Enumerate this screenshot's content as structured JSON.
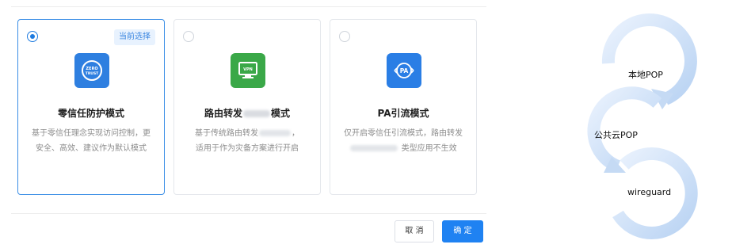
{
  "cards": [
    {
      "id": "zero-trust",
      "title": "零信任防护模式",
      "desc_lines": [
        "基于零信任理念实现访问控制，更",
        "安全、高效、建议作为默认模式"
      ],
      "selected": true,
      "badge": "当前选择",
      "icon": "zero-trust-icon",
      "icon_text_1": "ZERO",
      "icon_text_2": "TRUST"
    },
    {
      "id": "route-forward",
      "title_prefix": "路由转发",
      "title_suffix": "模式",
      "desc_line1_prefix": "基于传统路由转发",
      "desc_line1_suffix": "，",
      "desc_line2": "适用于作为灾备方案进行开启",
      "selected": false,
      "icon": "vpn-monitor-icon",
      "icon_text": "VPN"
    },
    {
      "id": "pa-divert",
      "title": "PA引流模式",
      "desc_line1": "仅开启零信任引流模式，路由转发",
      "desc_line2_suffix": "类型应用不生效",
      "selected": false,
      "icon": "pa-icon",
      "icon_text": "PA"
    }
  ],
  "actions": {
    "cancel_label": "取 消",
    "confirm_label": "确 定"
  },
  "diagram": {
    "labels": [
      "本地POP",
      "公共云POP",
      "wireguard"
    ]
  },
  "colors": {
    "accent": "#1f82f2",
    "selected_border": "#3a8ee6",
    "zero_trust_icon_bg": "#2e7fe0",
    "vpn_icon_bg": "#3aa848",
    "pa_icon_bg": "#2a7ee5",
    "flow_arrow": "#c9dcf5"
  }
}
